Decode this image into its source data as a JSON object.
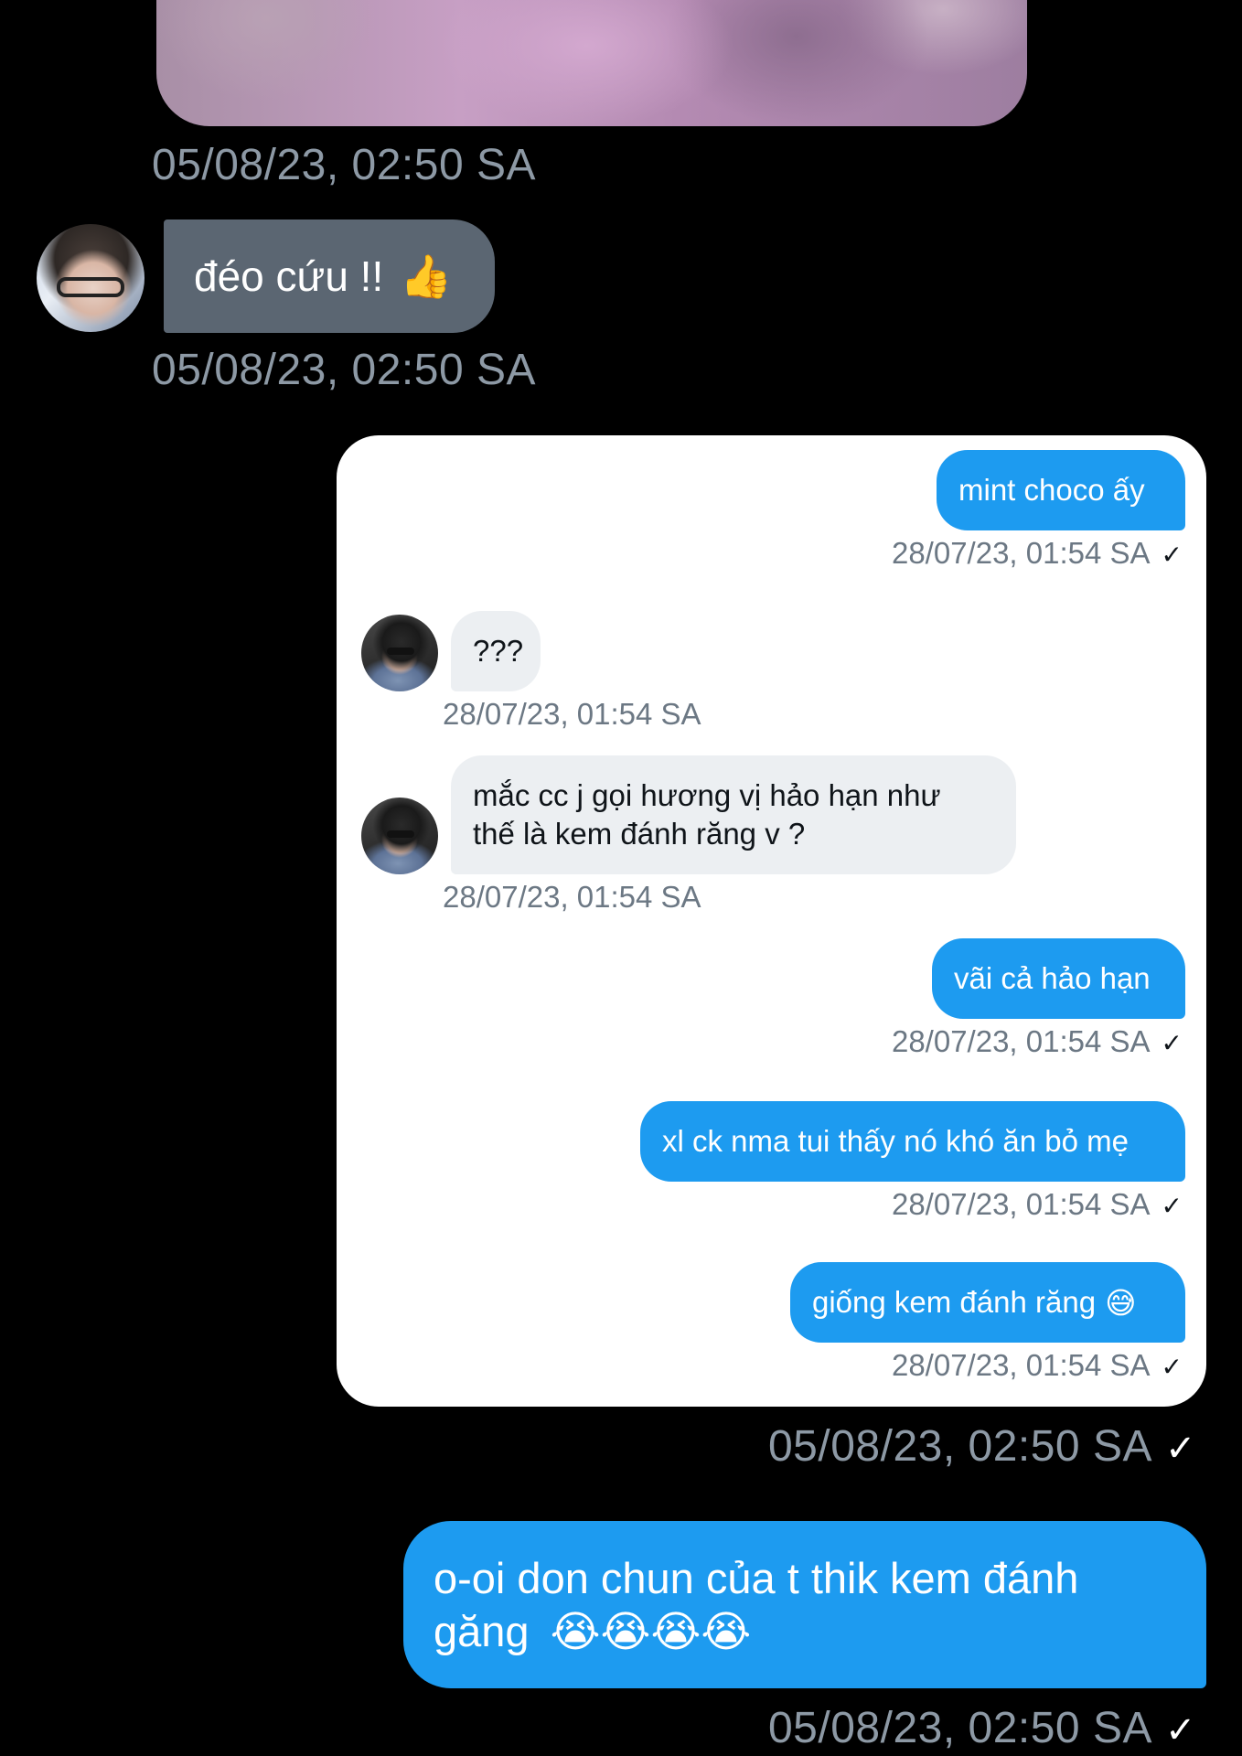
{
  "colors": {
    "background": "#000000",
    "outer_gray_bubble": "#5b6672",
    "blue_bubble": "#1d9bf0",
    "timestamp": "#8d99a5",
    "card_background": "#ffffff",
    "inner_gray_bubble": "#eceff2"
  },
  "icons": {
    "thumbs_up": "👍",
    "sweat_smile": "😅",
    "crying": "😭😭😭😭",
    "check": "✓"
  },
  "messages": {
    "image_timestamp": "05/08/23, 02:50 SA",
    "reply": {
      "text": "đéo cứu !!",
      "emoji": "👍",
      "timestamp": "05/08/23, 02:50 SA"
    },
    "shared_screenshot": {
      "timestamp": "05/08/23, 02:50 SA",
      "items": [
        {
          "sender": "me",
          "text": "mint choco ấy",
          "timestamp": "28/07/23, 01:54 SA"
        },
        {
          "sender": "them",
          "text": "???",
          "timestamp": "28/07/23, 01:54 SA"
        },
        {
          "sender": "them",
          "line1": "mắc cc j gọi hương vị hảo hạn như",
          "line2": "thế là kem đánh răng v ?",
          "timestamp": "28/07/23, 01:54 SA"
        },
        {
          "sender": "me",
          "text": "vãi cả hảo hạn",
          "timestamp": "28/07/23, 01:54 SA"
        },
        {
          "sender": "me",
          "text": "xl ck nma tui thấy nó khó ăn bỏ mẹ",
          "timestamp": "28/07/23, 01:54 SA"
        },
        {
          "sender": "me",
          "text": "giống kem đánh răng",
          "emoji": "😅",
          "timestamp": "28/07/23, 01:54 SA"
        }
      ]
    },
    "final": {
      "line1": "o-oi don chun của t thik kem đánh",
      "line2": "găng",
      "emoji": "😭😭😭😭",
      "timestamp": "05/08/23, 02:50 SA"
    }
  }
}
